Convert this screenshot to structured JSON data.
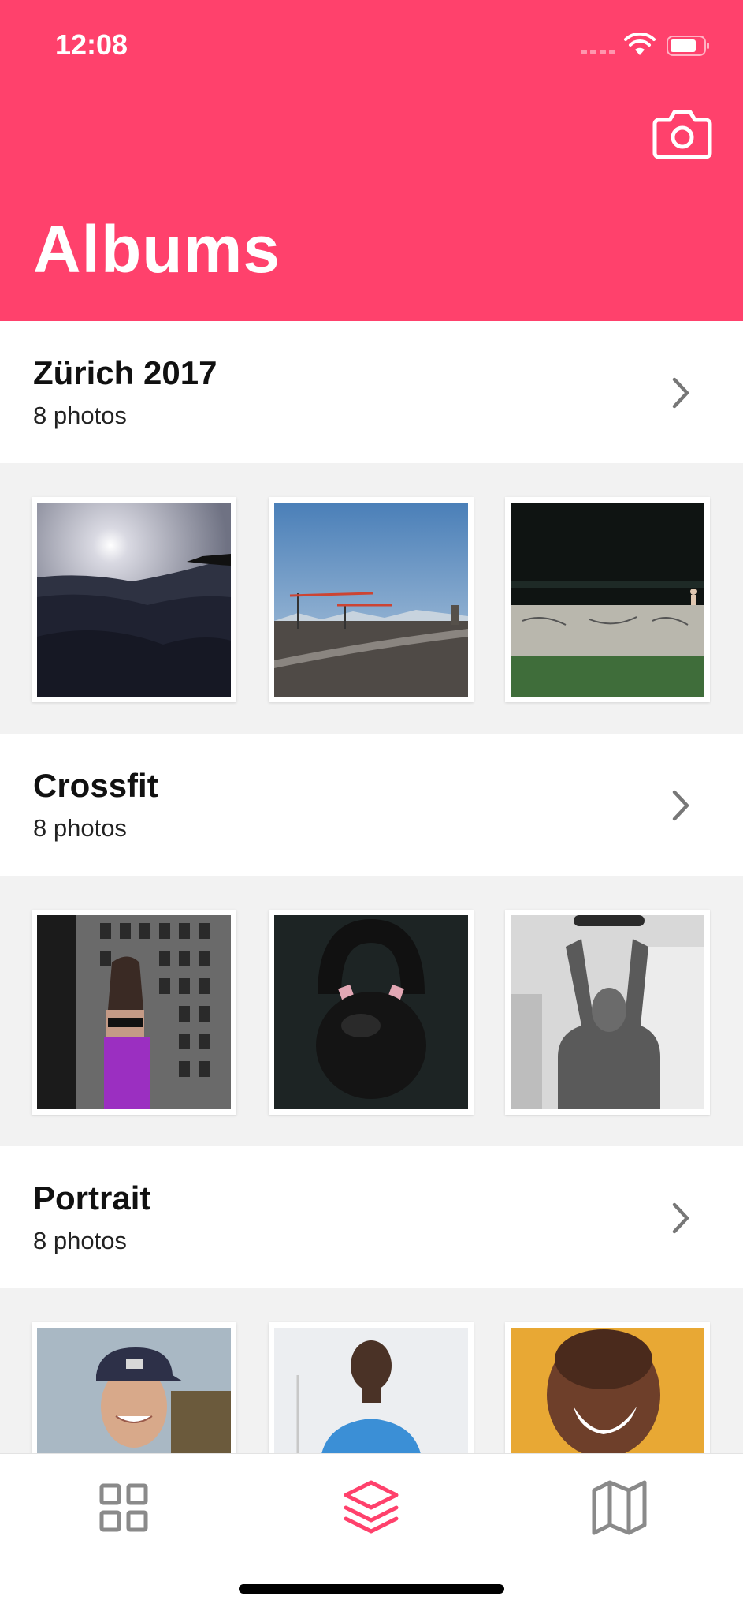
{
  "status_bar": {
    "time": "12:08"
  },
  "header": {
    "title": "Albums",
    "camera_icon": "camera-icon",
    "color": "#ff416c"
  },
  "albums": [
    {
      "title": "Zürich 2017",
      "count": "8 photos"
    },
    {
      "title": "Crossfit",
      "count": "8 photos"
    },
    {
      "title": "Portrait",
      "count": "8 photos"
    }
  ],
  "tabbar": {
    "tabs": [
      {
        "icon": "grid-icon",
        "active": false
      },
      {
        "icon": "layers-icon",
        "active": true
      },
      {
        "icon": "map-icon",
        "active": false
      }
    ],
    "active_color": "#ff416c",
    "inactive_color": "#8a8a8a"
  }
}
